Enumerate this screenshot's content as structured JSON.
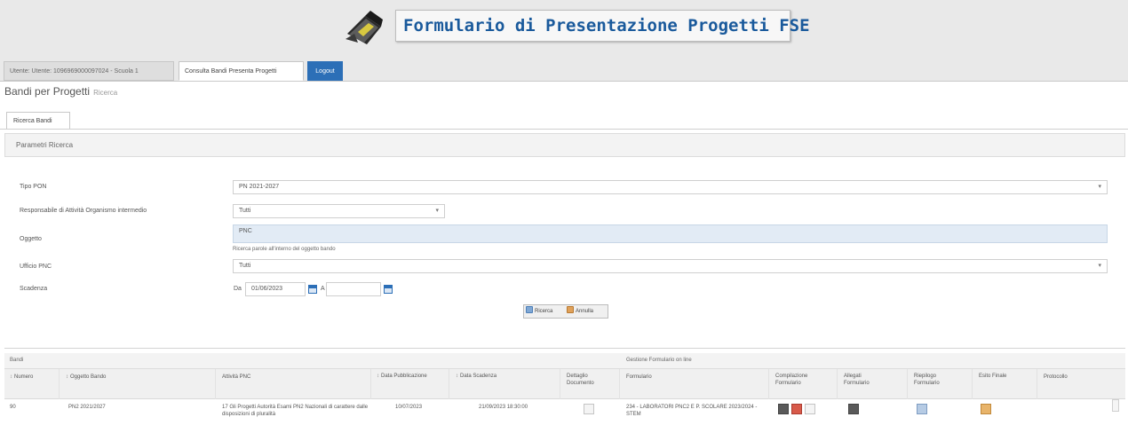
{
  "header": {
    "title": "Formulario di Presentazione Progetti FSE"
  },
  "tabs": {
    "user_tab": "Utente: Utente: 1096969000097024 - Scuola 1",
    "consulta_tab": "Consulta Bandi Presenta Progetti",
    "logout": "Logout"
  },
  "page": {
    "title": "Bandi per Progetti",
    "subtitle": "Ricerca"
  },
  "inner_tab": "Ricerca Bandi",
  "panel": {
    "title": "Parametri Ricerca"
  },
  "form": {
    "tipo_pon": {
      "label": "Tipo PON",
      "value": "PN 2021-2027"
    },
    "responsabile": {
      "label": "Responsabile di Attività Organismo intermedio",
      "value": "Tutti"
    },
    "oggetto": {
      "label": "Oggetto",
      "value": "PNC",
      "hint": "Ricerca parole all'interno del oggetto bando"
    },
    "ufficio": {
      "label": "Ufficio PNC",
      "value": "Tutti"
    },
    "scadenza": {
      "label": "Scadenza",
      "da_label": "Da",
      "da_value": "01/06/2023",
      "a_label": "A",
      "a_value": ""
    }
  },
  "buttons": {
    "cerca": "Ricerca",
    "annulla": "Annulla"
  },
  "grid": {
    "title": "Bandi",
    "sub_header": "Gestione Formulario on line",
    "columns": {
      "numero": "Numero",
      "oggetto": "Oggetto Bando",
      "attivita": "Attività PNC",
      "data_pub": "Data Pubblicazione",
      "data_scad": "Data Scadenza",
      "dettaglio": "Dettaglio Documento",
      "formulario": "Formulario",
      "compilazione": "Compilazione Formulario",
      "allegati": "Allegati Formulario",
      "riepilogo": "Riepilogo Formulario",
      "esito": "Esito Finale",
      "protocollo": "Protocollo"
    },
    "rows": [
      {
        "numero": "90",
        "oggetto": "PN2 2021/2027",
        "attivita": "17 Gli Progetti Autorità Esami PN2 Nazionali di carattere dalle disposizioni di pluralità",
        "data_pub": "10/07/2023",
        "data_scad": "21/09/2023 18:30:00",
        "formulario": "234 - LABORATORI PNC2 E P. SCOLARE 2023/2024 - STEM"
      }
    ]
  },
  "colors": {
    "brand_blue": "#1a5a9c",
    "logout_blue": "#2c6fb7",
    "header_gray": "#e9e9e9"
  }
}
